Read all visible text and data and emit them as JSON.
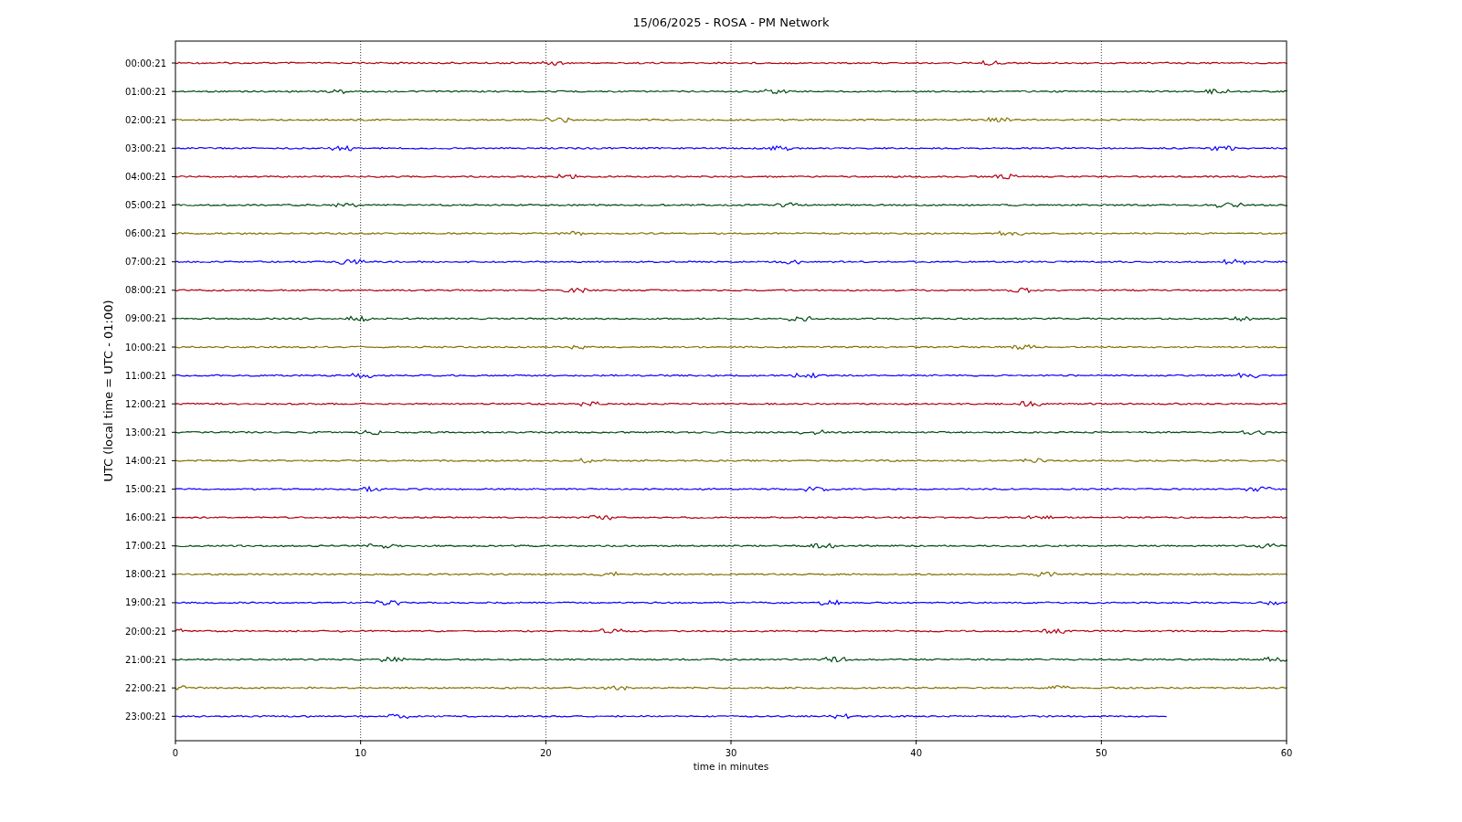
{
  "title": "15/06/2025 - ROSA - PM Network",
  "ylabel": "UTC (local time = UTC - 01:00)",
  "xlabel": "time in minutes",
  "xticks": [
    "0",
    "10",
    "20",
    "30",
    "40",
    "50",
    "60"
  ],
  "traces": [
    {
      "label": "00:00:21",
      "color": "#b2000f",
      "level": 1
    },
    {
      "label": "01:00:21",
      "color": "#004c12",
      "level": 1
    },
    {
      "label": "02:00:21",
      "color": "#847200",
      "level": 1
    },
    {
      "label": "03:00:21",
      "color": "#0e01ff",
      "level": 1
    },
    {
      "label": "04:00:21",
      "color": "#b2000f",
      "level": 1
    },
    {
      "label": "05:00:21",
      "color": "#004c12",
      "level": 1
    },
    {
      "label": "06:00:21",
      "color": "#847200",
      "level": 1
    },
    {
      "label": "07:00:21",
      "color": "#0e01ff",
      "level": 1
    },
    {
      "label": "08:00:21",
      "color": "#b2000f",
      "level": 1
    },
    {
      "label": "09:00:21",
      "color": "#004c12",
      "level": 1
    },
    {
      "label": "10:00:21",
      "color": "#847200",
      "level": 1
    },
    {
      "label": "11:00:21",
      "color": "#0e01ff",
      "level": 1
    },
    {
      "label": "12:00:21",
      "color": "#b2000f",
      "level": 1
    },
    {
      "label": "13:00:21",
      "color": "#004c12",
      "level": 1
    },
    {
      "label": "14:00:21",
      "color": "#847200",
      "level": 1
    },
    {
      "label": "15:00:21",
      "color": "#0e01ff",
      "level": 1
    },
    {
      "label": "16:00:21",
      "color": "#b2000f",
      "level": 1
    },
    {
      "label": "17:00:21",
      "color": "#004c12",
      "level": 1
    },
    {
      "label": "18:00:21",
      "color": "#847200",
      "level": 1
    },
    {
      "label": "19:00:21",
      "color": "#0e01ff",
      "level": 1
    },
    {
      "label": "20:00:21",
      "color": "#b2000f",
      "level": 1
    },
    {
      "label": "21:00:21",
      "color": "#004c12",
      "level": 1
    },
    {
      "label": "22:00:21",
      "color": "#847200",
      "level": 1
    },
    {
      "label": "23:00:21",
      "color": "#0e01ff",
      "level": 0.892
    }
  ]
}
